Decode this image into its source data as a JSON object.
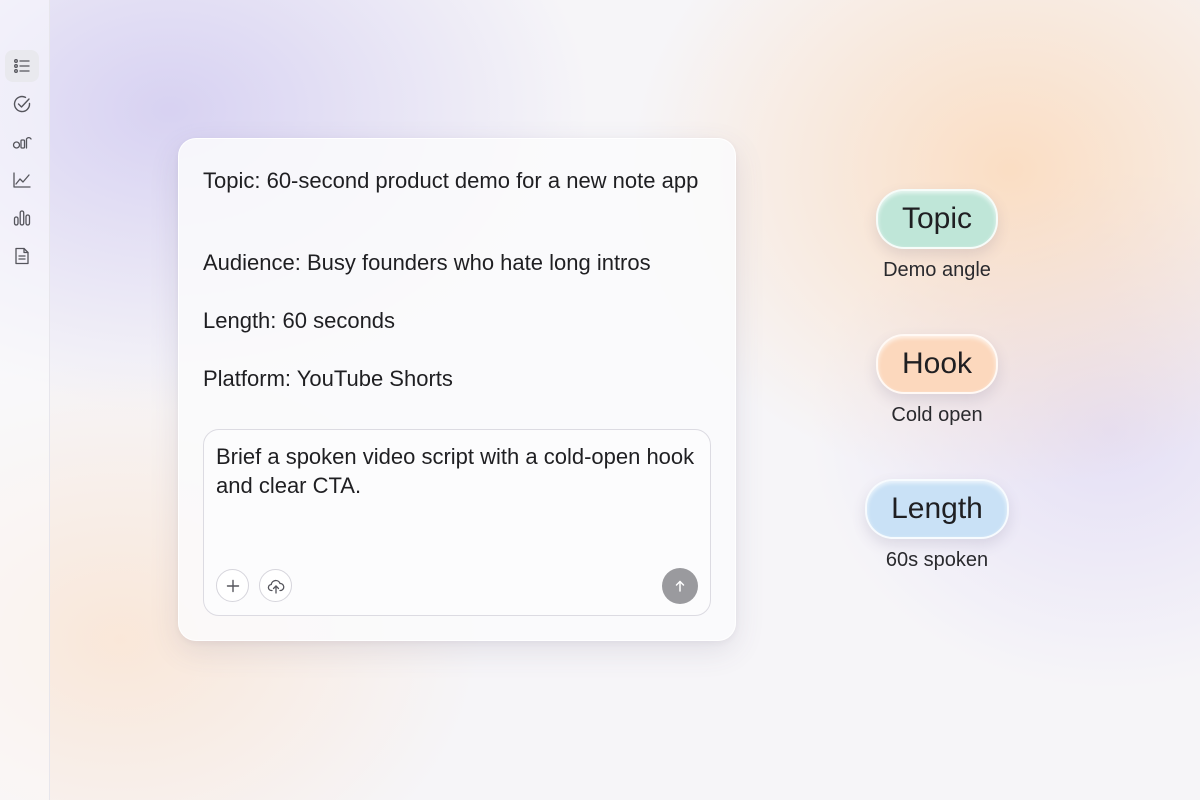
{
  "sidebar": {
    "items": [
      {
        "icon": "list-icon",
        "active": true
      },
      {
        "icon": "check-circle-icon",
        "active": false
      },
      {
        "icon": "shapes-icon",
        "active": false
      },
      {
        "icon": "line-chart-icon",
        "active": false
      },
      {
        "icon": "bar-chart-icon",
        "active": false
      },
      {
        "icon": "document-icon",
        "active": false
      }
    ]
  },
  "brief": {
    "topic": "Topic: 60-second product demo for a new note app",
    "audience": "Audience: Busy founders who hate long intros",
    "length": "Length: 60 seconds",
    "platform": "Platform: YouTube Shorts"
  },
  "composer": {
    "text": "Brief a spoken video script with a cold-open hook and clear CTA.",
    "buttons": [
      "plus-icon",
      "cloud-upload-icon"
    ],
    "send_icon": "arrow-up-icon"
  },
  "tags": [
    {
      "label": "Topic",
      "caption": "Demo angle",
      "color": "#bfe6d8"
    },
    {
      "label": "Hook",
      "caption": "Cold open",
      "color": "#fcd8bd"
    },
    {
      "label": "Length",
      "caption": "60s spoken",
      "color": "#c9e1f6"
    }
  ],
  "colors": {
    "accent_send": "#9a9a9e",
    "text": "#1f1f22",
    "sidebar_active": "#e9e9ee"
  }
}
